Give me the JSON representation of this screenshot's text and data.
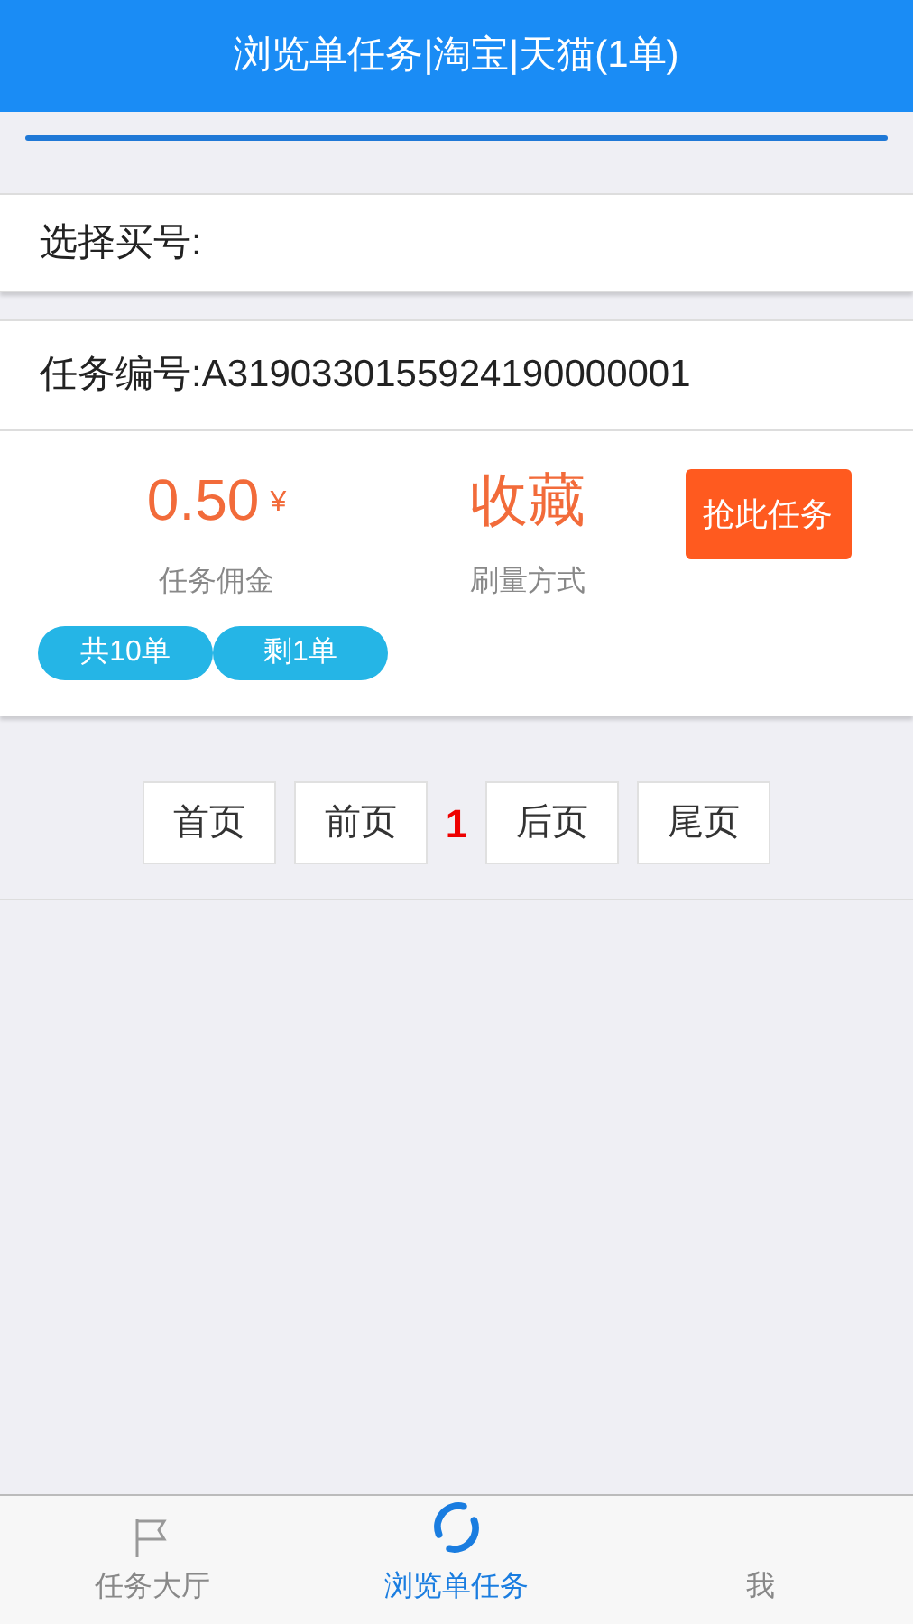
{
  "header": {
    "title": "浏览单任务|淘宝|天猫(1单)"
  },
  "buyer": {
    "label": "选择买号:"
  },
  "task": {
    "number": "任务编号:A3190330155924190000001",
    "commission": "0.50",
    "currency": "¥",
    "commission_label": "任务佣金",
    "method": "收藏",
    "method_label": "刷量方式",
    "grab_button": "抢此任务",
    "tags": [
      "共10单",
      "剩1单"
    ]
  },
  "pagination": {
    "first": "首页",
    "prev": "前页",
    "current": "1",
    "next": "后页",
    "last": "尾页"
  },
  "bottom_nav": [
    {
      "label": "任务大厅",
      "selected": false
    },
    {
      "label": "浏览单任务",
      "selected": true
    },
    {
      "label": "我",
      "selected": false
    }
  ]
}
